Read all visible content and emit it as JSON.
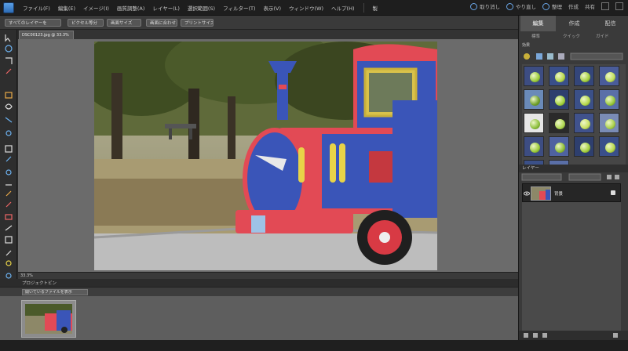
{
  "menubar": {
    "items": [
      {
        "label": "ファイル(F)"
      },
      {
        "label": "編集(E)"
      },
      {
        "label": "イメージ(I)"
      },
      {
        "label": "画質調整(A)"
      },
      {
        "label": "レイヤー(L)"
      },
      {
        "label": "選択範囲(S)"
      },
      {
        "label": "フィルター(T)"
      },
      {
        "label": "表示(V)"
      },
      {
        "label": "ウィンドウ(W)"
      },
      {
        "label": "ヘルプ(H)"
      }
    ],
    "mode_label": "製",
    "right": {
      "undo_label": "取り消し",
      "redo_label": "やり直し",
      "organizer_label": "整理",
      "create_label": "作成",
      "share_label": "共有"
    }
  },
  "options": {
    "buttons": [
      {
        "label": "すべてのレイヤーを"
      },
      {
        "label": "ピクセル等分"
      },
      {
        "label": "画面サイズ"
      },
      {
        "label": "画面に合わせる"
      },
      {
        "label": "プリントサイズ"
      }
    ]
  },
  "document": {
    "tab_label": "DSC00123.jpg @ 33.3%"
  },
  "status": {
    "zoom": "33.3%"
  },
  "bin": {
    "header": "プロジェクトビン",
    "dropdown": "開いているファイルを表示"
  },
  "panel": {
    "tabs": [
      {
        "label": "編集"
      },
      {
        "label": "作成"
      },
      {
        "label": "配信"
      }
    ],
    "subtabs": [
      {
        "label": "標準"
      },
      {
        "label": "クイック"
      },
      {
        "label": "ガイド"
      }
    ],
    "effects_header": "効果",
    "layers_header": "レイヤー",
    "layer_name": "背景"
  },
  "colors": {
    "accent": "#4a90d9",
    "panel_bg": "#3a3a3a",
    "canvas_bg": "#6b6b6b"
  }
}
